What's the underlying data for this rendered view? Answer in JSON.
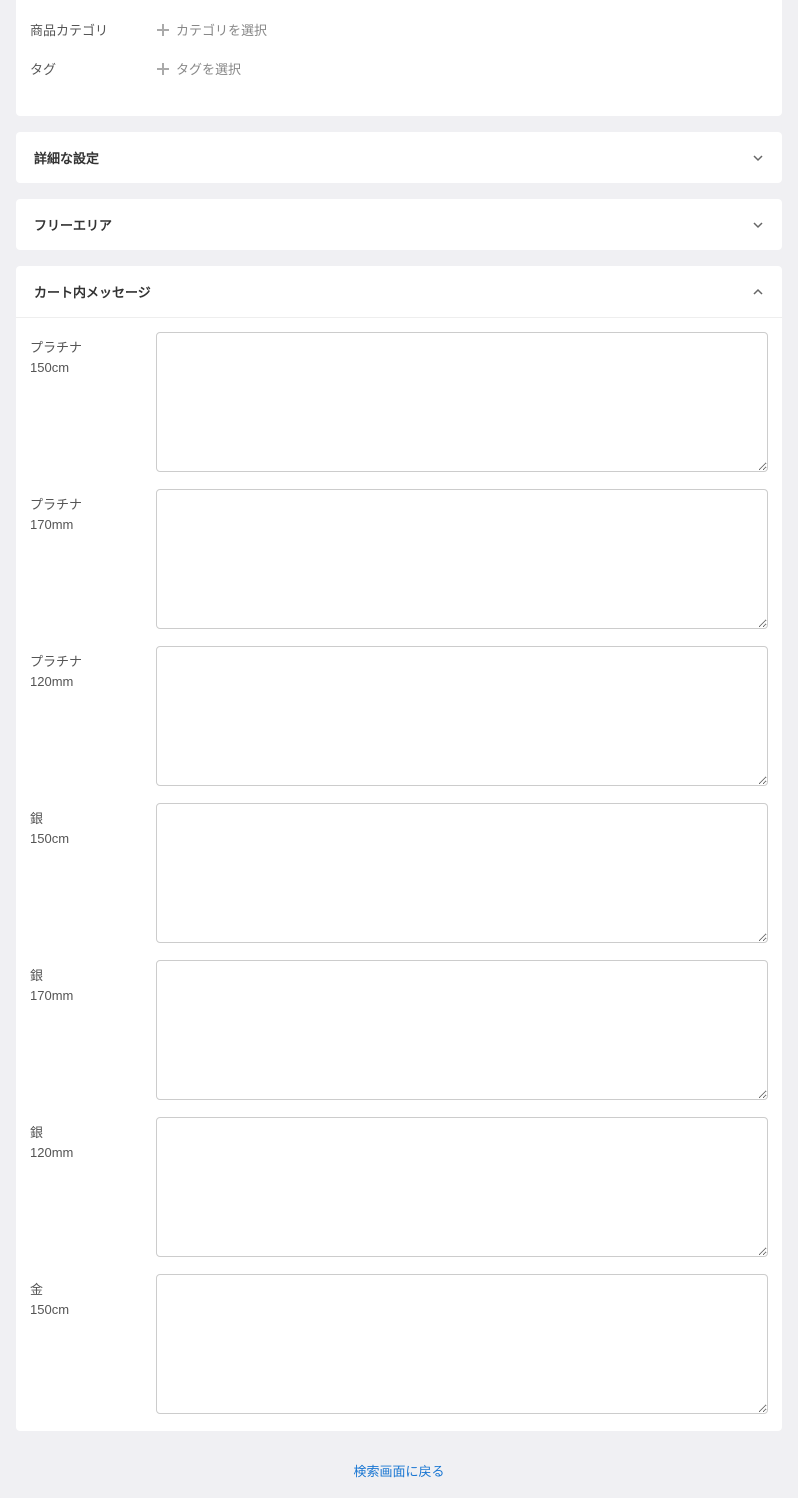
{
  "metaSection": {
    "categoryLabel": "商品カテゴリ",
    "categoryAction": "カテゴリを選択",
    "tagLabel": "タグ",
    "tagAction": "タグを選択"
  },
  "accordions": {
    "advanced": {
      "title": "詳細な設定"
    },
    "freeArea": {
      "title": "フリーエリア"
    },
    "cartMessage": {
      "title": "カート内メッセージ"
    }
  },
  "cartMessageItems": [
    {
      "label": "プラチナ\n150cm",
      "value": ""
    },
    {
      "label": "プラチナ\n170mm",
      "value": ""
    },
    {
      "label": "プラチナ\n120mm",
      "value": ""
    },
    {
      "label": "銀\n150cm",
      "value": ""
    },
    {
      "label": "銀\n170mm",
      "value": ""
    },
    {
      "label": "銀\n120mm",
      "value": ""
    },
    {
      "label": "金\n150cm",
      "value": ""
    }
  ],
  "backLink": "検索画面に戻る"
}
